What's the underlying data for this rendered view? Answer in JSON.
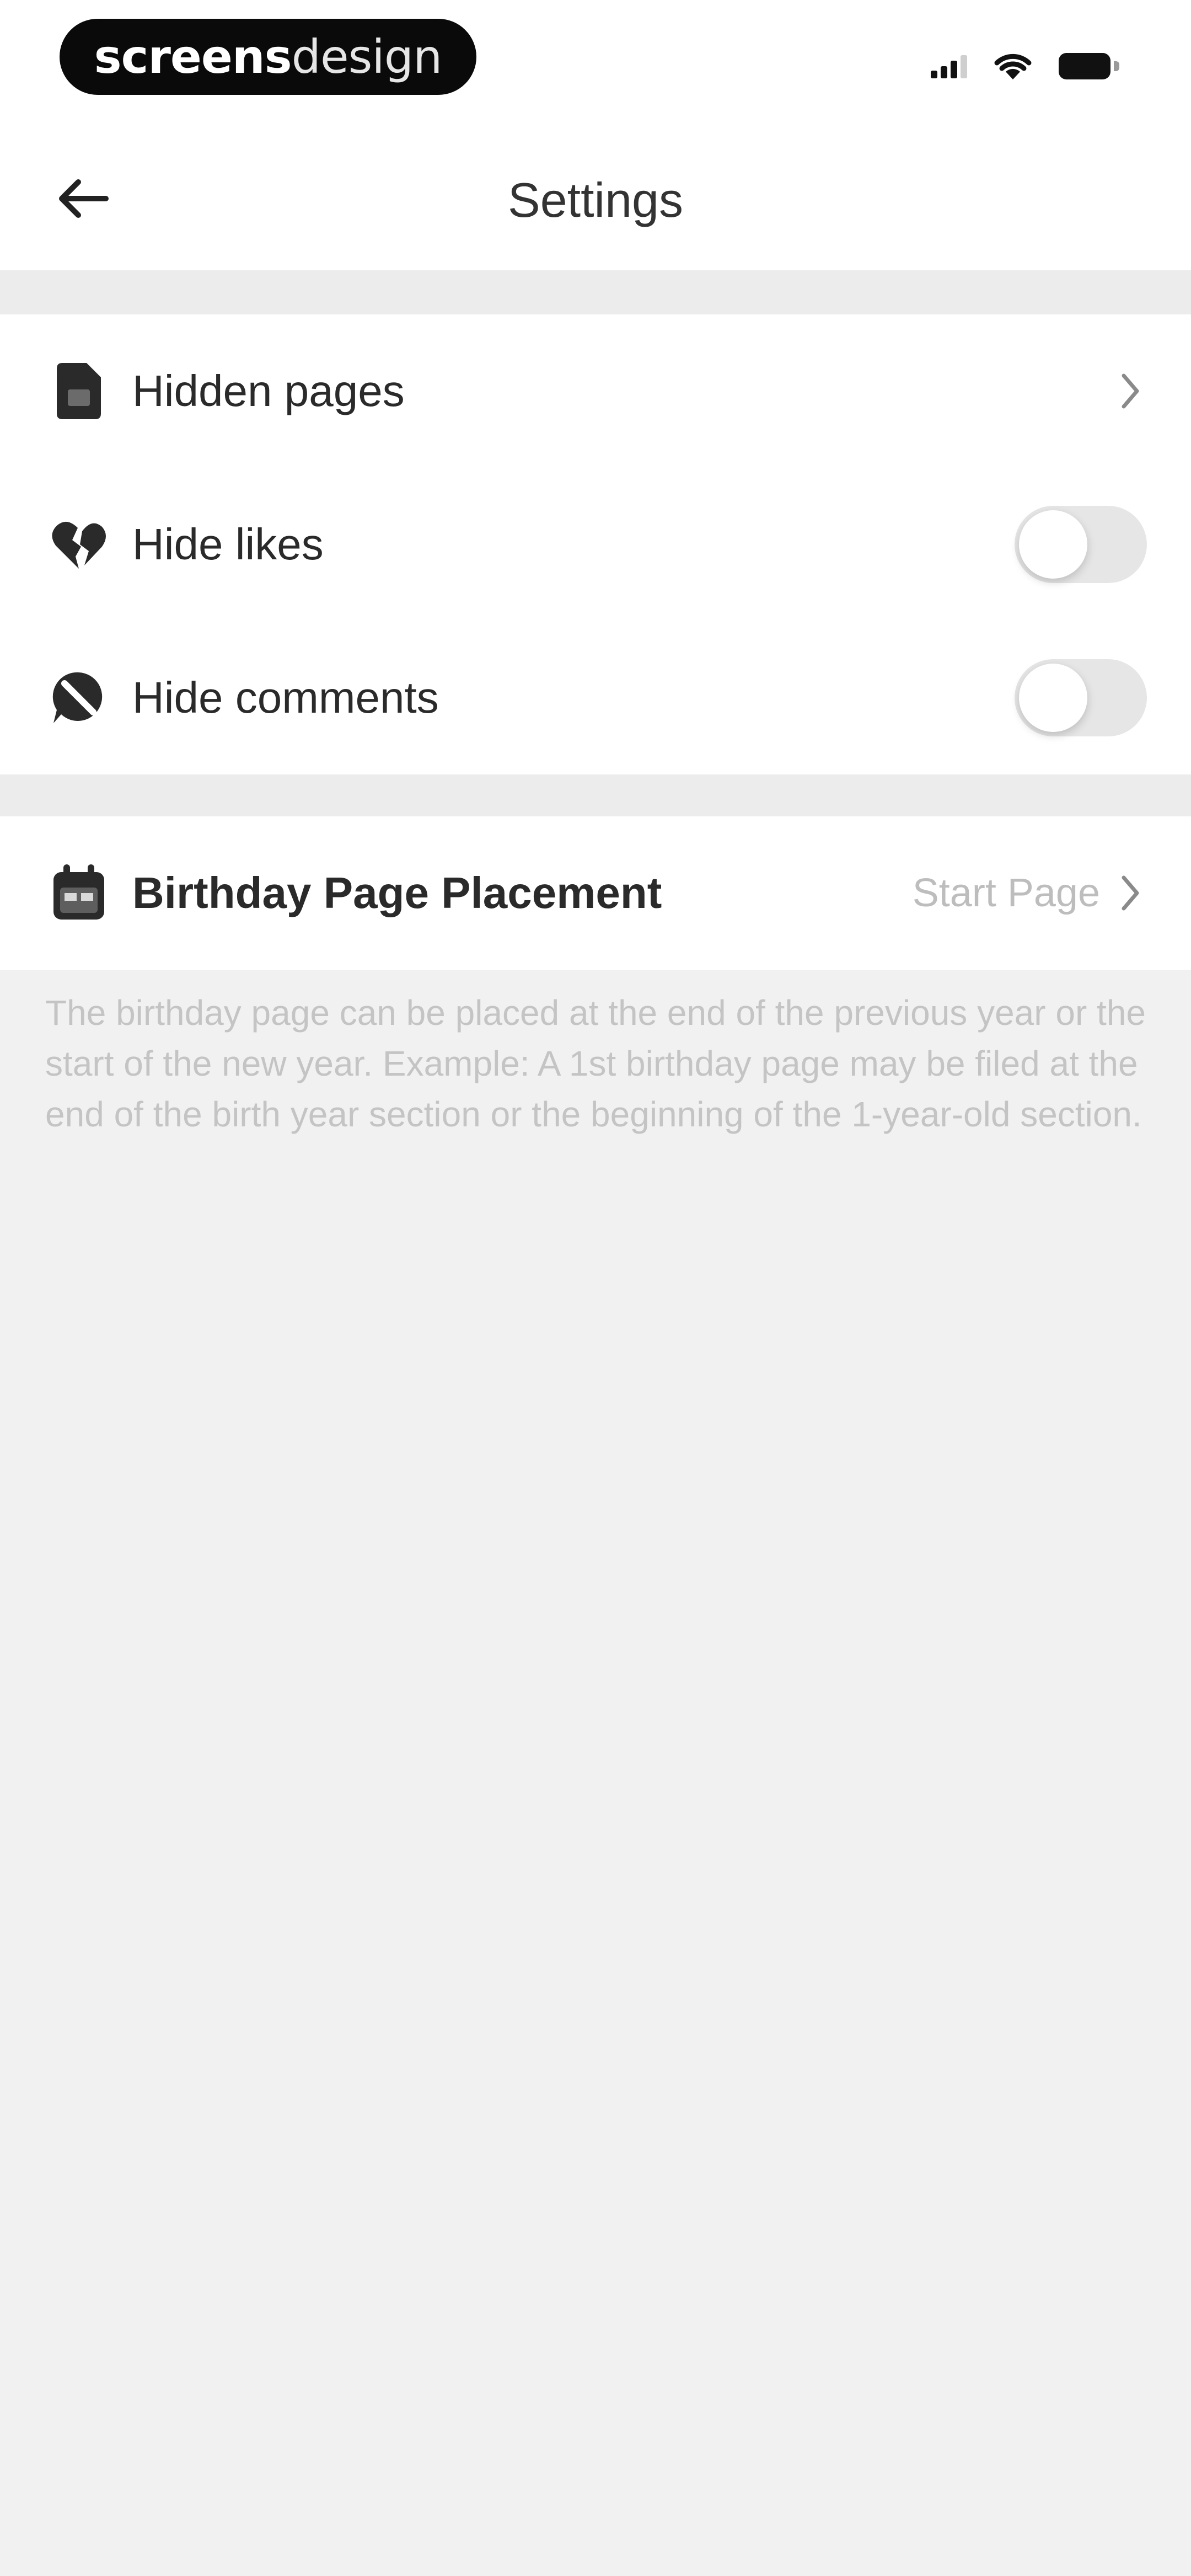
{
  "status_bar": {
    "brand_bold": "screens",
    "brand_light": "design"
  },
  "header": {
    "title": "Settings",
    "back_icon": "arrow-left-icon"
  },
  "groups": [
    {
      "items": [
        {
          "label": "Hidden pages",
          "icon": "document-icon",
          "control": "chevron"
        },
        {
          "label": "Hide likes",
          "icon": "broken-heart-icon",
          "control": "toggle",
          "on": false
        },
        {
          "label": "Hide comments",
          "icon": "comment-off-icon",
          "control": "toggle",
          "on": false
        }
      ]
    },
    {
      "items": [
        {
          "label": "Birthday Page Placement",
          "icon": "calendar-icon",
          "control": "chevron",
          "value": "Start Page"
        }
      ]
    }
  ],
  "footnote": "The birthday page can be placed at the end of the previous year or the start of the new year. Example: A 1st birthday page may be filed at the end of the birth year section or the beginning of the 1-year-old section.",
  "colors": {
    "background": "#f1f1f1",
    "card": "#ffffff",
    "toggle_off": "#e6e6e6",
    "secondary_text": "#bdbdbd"
  }
}
